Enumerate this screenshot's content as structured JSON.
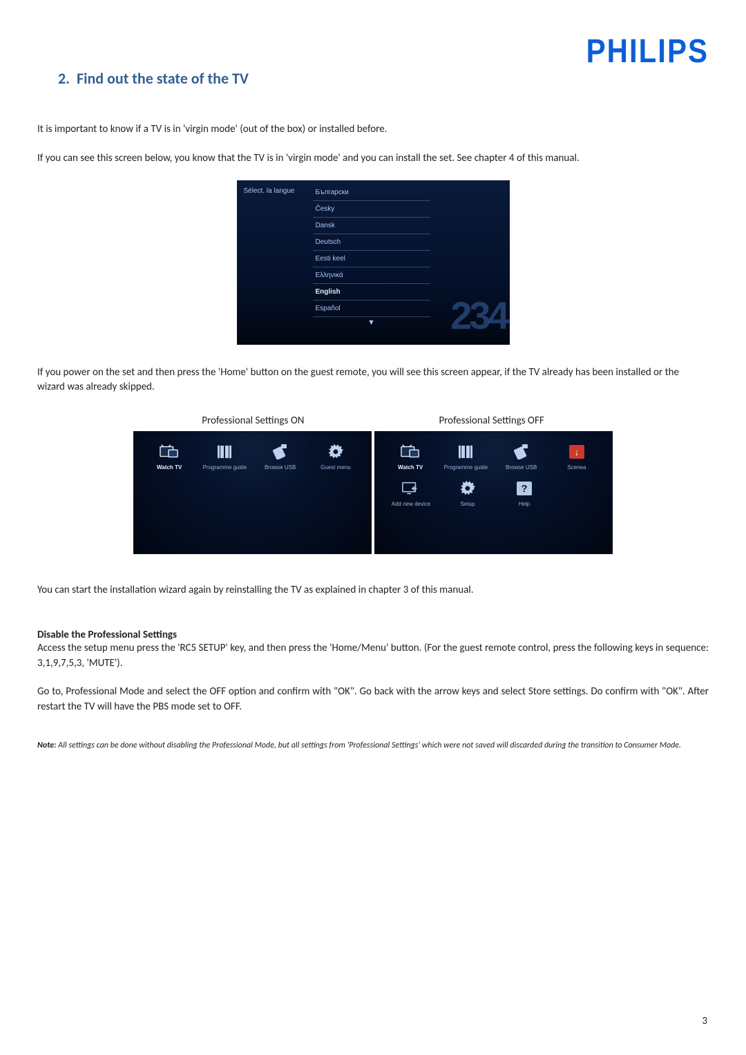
{
  "brand": "PHILIPS",
  "section": {
    "number": "2.",
    "title": "Find out the state of the TV"
  },
  "p1": "It is important to know if a TV is in 'virgin mode' (out of the box) or installed before.",
  "p2": "If you can see this screen below, you know that the TV is in 'virgin mode' and you can install the set. See chapter 4 of this manual.",
  "screenshot1": {
    "left_label": "Sélect. la langue",
    "languages": [
      "Български",
      "Česky",
      "Dansk",
      "Deutsch",
      "Eesti keel",
      "Ελληνικά",
      "English",
      "Español"
    ],
    "selected_language": "English",
    "big_digits": "234"
  },
  "p3": "If you power on the set and then press the 'Home' button on the guest remote, you will see this screen appear, if the TV already has been installed or the wizard was already skipped.",
  "labels": {
    "on": "Professional Settings ON",
    "off": "Professional Settings OFF"
  },
  "menu_on": {
    "row1": [
      {
        "icon": "tv",
        "label": "Watch TV",
        "selected": true
      },
      {
        "icon": "guide",
        "label": "Programme guide"
      },
      {
        "icon": "usb",
        "label": "Browse USB"
      },
      {
        "icon": "gear",
        "label": "Guest menu"
      }
    ]
  },
  "menu_off": {
    "row1": [
      {
        "icon": "tv",
        "label": "Watch TV",
        "selected": true
      },
      {
        "icon": "guide",
        "label": "Programme guide"
      },
      {
        "icon": "usb",
        "label": "Browse USB"
      },
      {
        "icon": "scenea",
        "label": "Scenea"
      }
    ],
    "row2": [
      {
        "icon": "add",
        "label": "Add new device"
      },
      {
        "icon": "gear",
        "label": "Setup"
      },
      {
        "icon": "help",
        "label": "Help"
      }
    ]
  },
  "p4": "You can start the installation wizard again by reinstalling the TV as explained in chapter 3 of this manual.",
  "disable": {
    "heading": "Disable the Professional Settings",
    "p1": "Access the setup menu press the 'RC5 SETUP' key, and then press the 'Home/Menu' button. (For the guest remote control, press the following keys in sequence: 3,1,9,7,5,3, 'MUTE').",
    "p2": "Go to, Professional Mode and select the OFF option and confirm with \"OK\".  Go back with the arrow keys and select Store settings. Do confirm with \"OK\". After restart the TV will have the PBS mode set to OFF."
  },
  "note": {
    "label": "Note:",
    "text": " All settings can be done without disabling the Professional Mode, but  all settings from 'Professional Settings' which were not saved will discarded during the transition to Consumer Mode."
  },
  "page_number": "3"
}
